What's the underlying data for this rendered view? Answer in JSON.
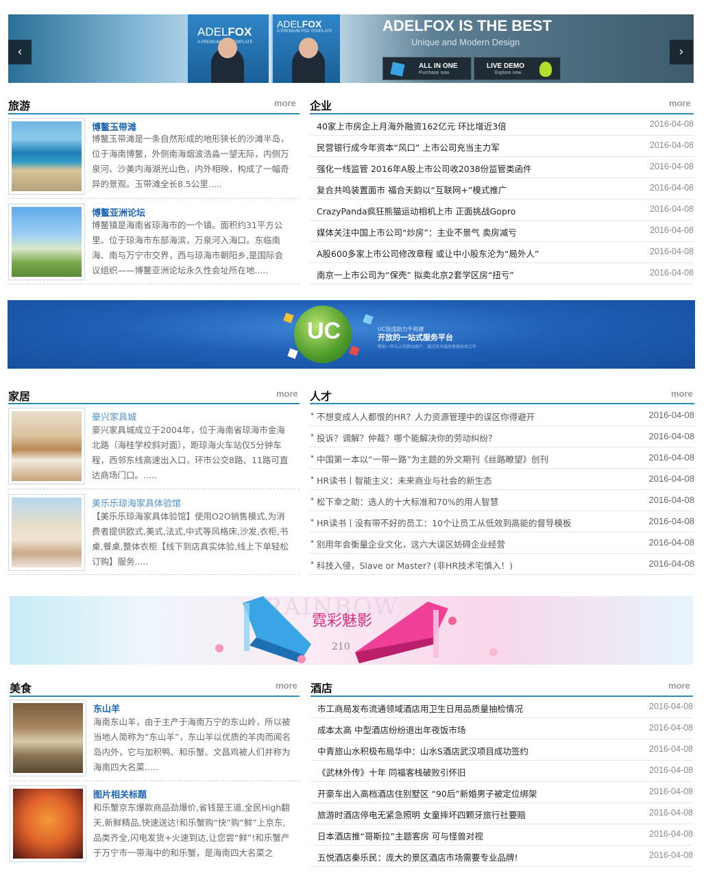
{
  "slider": {
    "box_brand_light": "ADEL",
    "box_brand_bold": "FOX",
    "box_tagline": "A PREMIUM PSD TEMPLATE",
    "headline": "ADELFOX IS THE BEST",
    "subheadline": "Unique and Modern Design",
    "cta1_title": "ALL IN ONE",
    "cta1_sub": "Purchase now",
    "cta2_title": "LIVE DEMO",
    "cta2_sub": "Explore now",
    "prev_icon": "‹",
    "next_icon": "›"
  },
  "more_label": "more",
  "travel": {
    "title": "旅游",
    "items": [
      {
        "title": "博鳌玉带滩",
        "desc": "博鳌玉带滩是一条自然形成的地形狭长的沙滩半岛，位于海南博鳌，外侧南海烟波浩淼一望无际，内侧万泉河、沙美内海湖光山色，内外相映，构成了一幅奇异的景观。玉带滩全长8.5公里....."
      },
      {
        "title": "博鳌亚洲论坛",
        "desc": "博鳌镇是海南省琼海市的一个镇。面积约31平方公里。位于琼海市东部海滨，万泉河入海口。东临南海、南与万宁市交界，西与琼海市朝阳乡,是国际会议组织——博鳌亚洲论坛永久性会址所在地....."
      }
    ]
  },
  "business": {
    "title": "企业",
    "items": [
      {
        "text": "40家上市房企上月海外融资162亿元 环比增近3倍",
        "date": "2016-04-08"
      },
      {
        "text": "民营银行成今年资本“风口” 上市公司充当主力军",
        "date": "2016-04-08"
      },
      {
        "text": "强化一线监管 2016年A股上市公司收2038份监管类函件",
        "date": "2016-04-08"
      },
      {
        "text": "复合共鸣装置面市 福合天韵以“互联网+”模式推广",
        "date": "2016-04-08"
      },
      {
        "text": "CrazyPanda疯狂熊猫运动相机上市 正面挑战Gopro",
        "date": "2016-04-08"
      },
      {
        "text": "媒体关注中国上市公司“炒房”：主业不景气 卖房减亏",
        "date": "2016-04-08"
      },
      {
        "text": "A股600多家上市公司修改章程 或让中小股东沦为“局外人”",
        "date": "2016-04-08"
      },
      {
        "text": "南京一上市公司为“保壳” 拟卖北京2套学区房“扭亏”",
        "date": "2016-04-08"
      }
    ]
  },
  "uc_banner": {
    "logo": "UC",
    "line1": "UC技成助力千构建",
    "line2": "开放的一站式服务平台",
    "line3": "帮助一年以上的移动用户，通过技术服务营销各项工作"
  },
  "home": {
    "title": "家居",
    "items": [
      {
        "title": "豪兴家具城",
        "desc": "豪兴家具城成立于2004年，位于海南省琼海市金海北路（海桂学校斜对面），距琼海火车站仅5分钟车程，西邻东线高速出入口，环市公交8路、11路可直达商场门口。....."
      },
      {
        "title": "美乐乐琼海家具体验馆",
        "desc": "【美乐乐琼海家具体验馆】使用O2O销售模式,为消费者提供欧式,美式,法式,中式等风格床,沙发,衣柜,书桌,餐桌,整体衣柜【线下到店真实体验,线上下单轻松订购】服务....."
      }
    ]
  },
  "talent": {
    "title": "人才",
    "bullet": "•",
    "items": [
      {
        "text": "不想变成人人都恨的HR？人力资源管理中的误区你得避开",
        "date": "2016-04-08"
      },
      {
        "text": "投诉？调解？仲裁？哪个能解决你的劳动纠纷？",
        "date": "2016-04-08"
      },
      {
        "text": "中国第一本以“一带一路”为主题的外文期刊《丝路瞭望》创刊",
        "date": "2016-04-08"
      },
      {
        "text": "HR读书丨智能主义：未来商业与社会的新生态",
        "date": "2016-04-08"
      },
      {
        "text": "松下幸之助：选人的十大标准和70%的用人智慧",
        "date": "2016-04-08"
      },
      {
        "text": "HR读书丨没有带不好的员工：10个让员工从低效到高能的督导模板",
        "date": "2016-04-08"
      },
      {
        "text": "别用年会衡量企业文化，这六大误区妨碍企业经营",
        "date": "2016-04-08"
      },
      {
        "text": "科技入侵，Slave or Master? (非HR技术宅慎入！)",
        "date": "2016-04-08"
      }
    ]
  },
  "shoe_banner": {
    "watermark": "RAINBOW",
    "title": "霓彩魅影",
    "number": "210"
  },
  "food": {
    "title": "美食",
    "items": [
      {
        "title": "东山羊",
        "desc": "海南东山羊，由于主产于海南万宁的东山岭，所以被当地人简称为“东山羊”，东山羊以优质的羊肉而闻名岛内外，它与加积鸭、和乐蟹、文昌鸡被人们并称为海南四大名菜....."
      },
      {
        "title": "图片相关标题",
        "desc": "和乐蟹京东爆款商品劲爆价,省钱是王道,全民High翻天,新鲜精品,快速送达!和乐蟹购“快”购“鲜”上京东,品类齐全,闪电发货+火速到达,让您尝“鲜”!和乐蟹产于万宁市一带海中的和乐蟹，是海南四大名菜之一....."
      }
    ]
  },
  "hotel": {
    "title": "酒店",
    "items": [
      {
        "text": "市工商局发布流通领域酒店用卫生日用品质量抽检情况",
        "date": "2016-04-08"
      },
      {
        "text": "成本太高 中型酒店纷纷退出年夜饭市场",
        "date": "2016-04-08"
      },
      {
        "text": "中青旅山水积极布局华中：山水S酒店武汉项目成功签约",
        "date": "2016-04-08"
      },
      {
        "text": "《武林外传》十年 同福客栈破败引怀旧",
        "date": "2016-04-08"
      },
      {
        "text": "开豪车出入高档酒店住别墅区 “90后”新婚男子被定位绑架",
        "date": "2016-04-08"
      },
      {
        "text": "旅游时酒店停电无紧急照明 女童摔坏四颗牙旅行社要赔",
        "date": "2016-04-08"
      },
      {
        "text": "日本酒店推“哥斯拉”主题客房 可与怪兽对视",
        "date": "2016-04-08"
      },
      {
        "text": "五悦酒店秦乐民：庞大的景区酒店市场需要专业品牌!",
        "date": "2016-04-08"
      }
    ]
  }
}
